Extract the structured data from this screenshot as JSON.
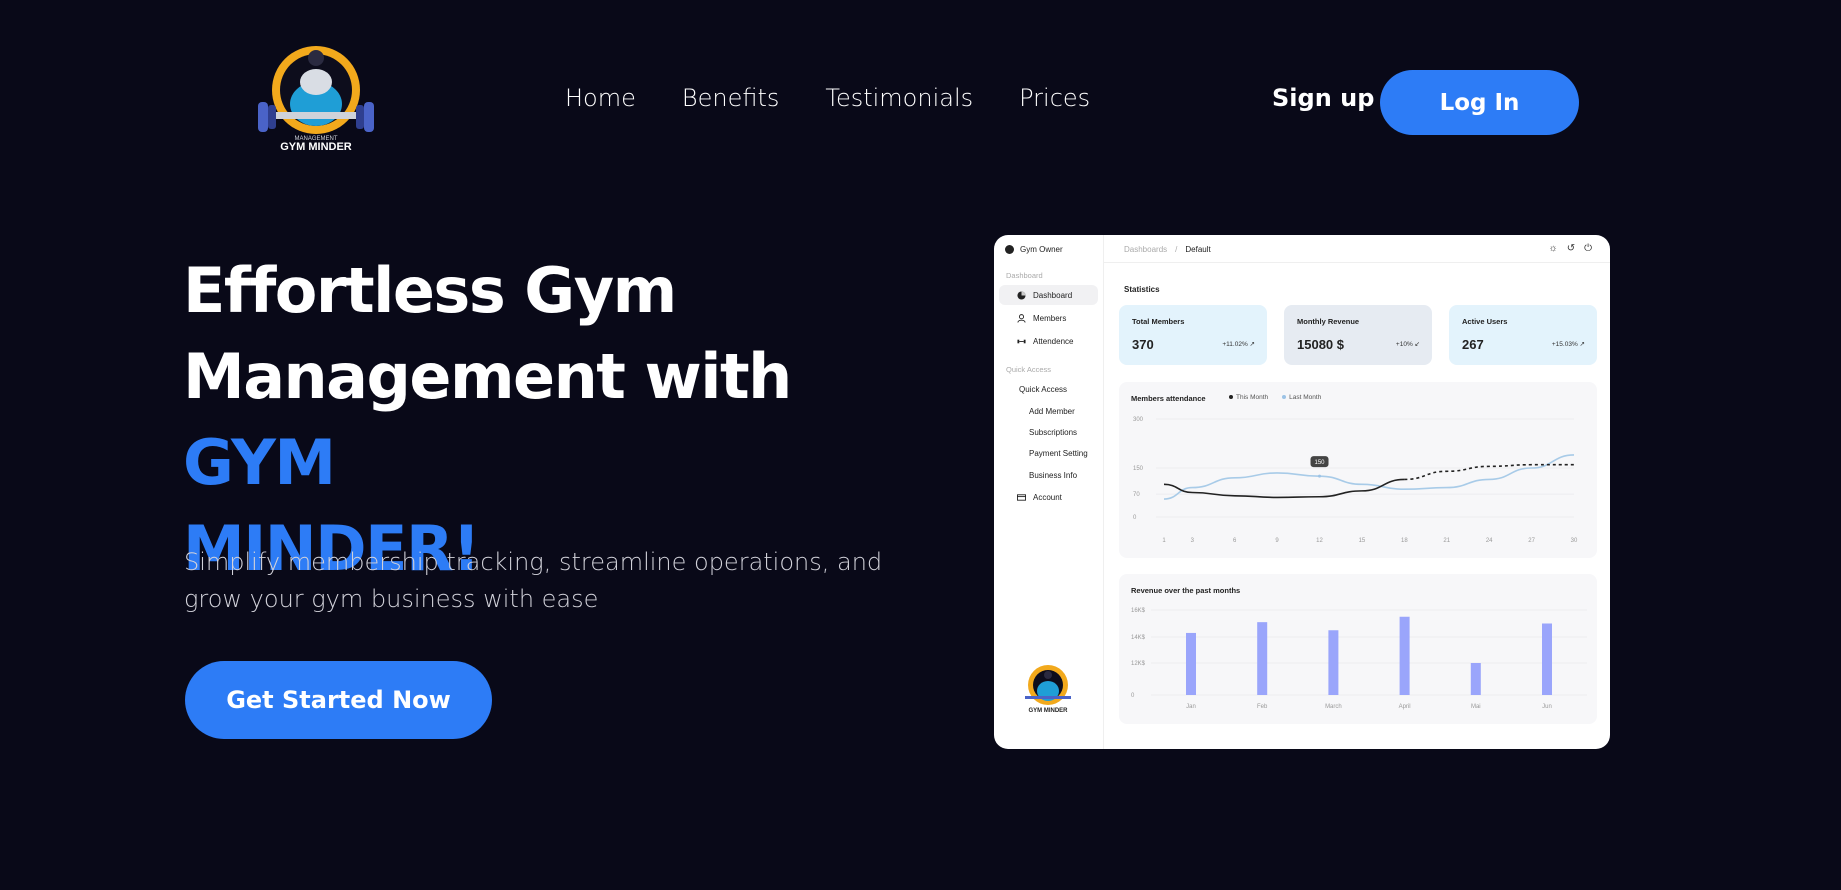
{
  "brand": {
    "logo_text": "GYM MINDER",
    "logo_sub": "MANAGEMENT"
  },
  "nav": {
    "items": [
      "Home",
      "Benefits",
      "Testimonials",
      "Prices"
    ]
  },
  "auth": {
    "signup": "Sign up",
    "login": "Log In"
  },
  "hero": {
    "title_line1": "Effortless Gym",
    "title_line2": "Management with ",
    "title_accent1": "GYM",
    "title_accent2": "MINDER!",
    "subtitle": "Simplify membership tracking, streamline operations, and grow your gym business with ease",
    "cta": "Get Started Now"
  },
  "colors": {
    "accent": "#2d7cf6",
    "background": "#090918",
    "bar": "#9aa5fb"
  },
  "dashboard": {
    "owner": "Gym Owner",
    "sidebar": {
      "section_dashboard": "Dashboard",
      "items": [
        {
          "label": "Dashboard",
          "icon": "pie-icon"
        },
        {
          "label": "Members",
          "icon": "user-icon"
        },
        {
          "label": "Attendence",
          "icon": "dumbbell-icon"
        }
      ],
      "section_quick": "Quick Access",
      "quick_access_label": "Quick Access",
      "quick_items": [
        "Add Member",
        "Subscriptions",
        "Payment Setting",
        "Business Info"
      ],
      "account_label": "Account"
    },
    "breadcrumb": [
      "Dashboards",
      "/",
      "Default"
    ],
    "statistics_title": "Statistics",
    "cards": [
      {
        "label": "Total Members",
        "value": "370",
        "change": "+11.02%",
        "bg": "#e3f3fc"
      },
      {
        "label": "Monthly Revenue",
        "value": "15080 $",
        "change": "+10%",
        "bg": "#e6ebf2"
      },
      {
        "label": "Active Users",
        "value": "267",
        "change": "+15.03%",
        "bg": "#e3f3fc"
      }
    ],
    "attendance": {
      "title": "Members attendance",
      "legend": [
        "This Month",
        "Last Month"
      ],
      "tooltip": "150"
    },
    "revenue_title": "Revenue over the past months"
  },
  "chart_data": [
    {
      "type": "line",
      "title": "Members attendance",
      "x": [
        1,
        3,
        6,
        9,
        12,
        15,
        18,
        21,
        24,
        27,
        30
      ],
      "yticks": [
        "300",
        "150",
        "70",
        "0"
      ],
      "ylim": [
        0,
        300
      ],
      "series": [
        {
          "name": "This Month",
          "values": [
            100,
            75,
            65,
            60,
            62,
            80,
            115,
            140,
            155,
            160,
            160
          ]
        },
        {
          "name": "Last Month",
          "values": [
            55,
            90,
            120,
            135,
            125,
            100,
            85,
            90,
            115,
            150,
            190
          ]
        }
      ],
      "annotation": "150"
    },
    {
      "type": "bar",
      "title": "Revenue over the past months",
      "categories": [
        "Jan",
        "Feb",
        "March",
        "April",
        "Mai",
        "Jun"
      ],
      "yticks": [
        "16K$",
        "14K$",
        "12K$",
        "0"
      ],
      "values": [
        14300,
        15100,
        14500,
        15500,
        12000,
        15000
      ]
    }
  ]
}
